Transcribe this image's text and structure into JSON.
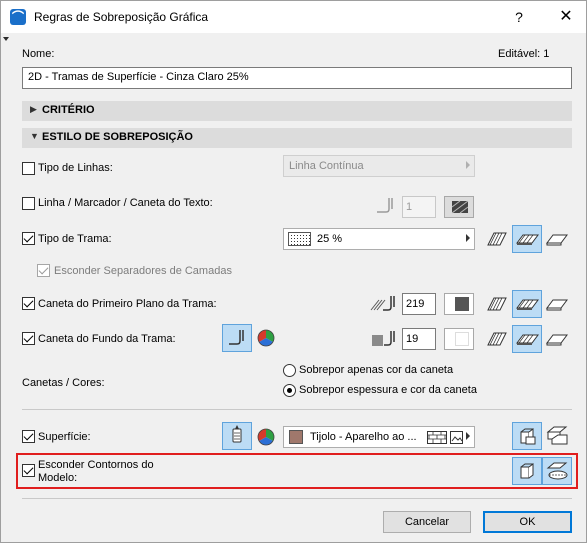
{
  "window": {
    "title": "Regras de Sobreposição Gráfica",
    "help": "?",
    "close": "✕"
  },
  "name": {
    "label": "Nome:",
    "value": "2D - Tramas de Superfície - Cinza Claro 25%",
    "editable": "Editável: 1"
  },
  "sections": {
    "criteria": "CRITÉRIO",
    "style": "ESTILO DE SOBREPOSIÇÃO"
  },
  "rows": {
    "line_type": {
      "label": "Tipo de Linhas:",
      "checked": false,
      "value": "Linha Contínua"
    },
    "line_marker": {
      "label": "Linha / Marcador / Caneta do Texto:",
      "checked": false,
      "pen": "1"
    },
    "hatch_type": {
      "label": "Tipo de Trama:",
      "checked": true,
      "value": "25 %"
    },
    "hide_separators": {
      "label": "Esconder Separadores de Camadas",
      "checked": true
    },
    "fg_pen": {
      "label": "Caneta do Primeiro Plano da Trama:",
      "checked": true,
      "pen": "219"
    },
    "bg_pen": {
      "label": "Caneta do Fundo da Trama:",
      "checked": true,
      "pen": "19"
    },
    "pens_colors": {
      "label": "Canetas / Cores:",
      "options": [
        "Sobrepor apenas cor da caneta",
        "Sobrepor espessura e cor da caneta"
      ],
      "selected_index": 1
    },
    "surface": {
      "label": "Superfície:",
      "checked": true,
      "value": "Tijolo - Aparelho ao ..."
    },
    "hide_contours": {
      "label_line1": "Esconder Contornos do",
      "label_line2": "Modelo:",
      "checked": true
    }
  },
  "buttons": {
    "cancel": "Cancelar",
    "ok": "OK"
  },
  "colors": {
    "active_button_bg": "#bcdcf5",
    "highlight_frame": "#e01e1e",
    "brick_swatch": "#a0786c",
    "fg_pen_swatch": "#555555",
    "bg_pen_swatch": "#ffffff"
  }
}
